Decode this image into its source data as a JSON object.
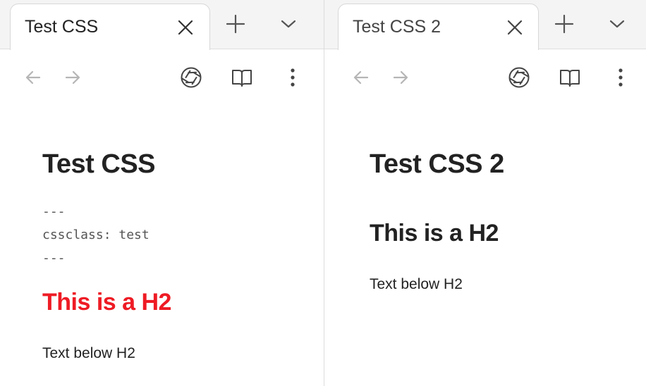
{
  "colors": {
    "h2_highlight": "#ee1b24",
    "text": "#222222",
    "icon_active": "#444444",
    "icon_disabled": "#b5b5b5",
    "tabbar_bg": "#f4f4f4"
  },
  "left_pane": {
    "tab": {
      "title": "Test CSS",
      "close_icon": "close-icon",
      "new_tab_icon": "plus-icon",
      "tab_list_icon": "chevron-down-icon"
    },
    "toolbar": {
      "back_icon": "arrow-left-icon",
      "forward_icon": "arrow-right-icon",
      "graph_icon": "aperture-icon",
      "reading_view_icon": "book-open-icon",
      "more_icon": "more-vertical-icon"
    },
    "note": {
      "title": "Test CSS",
      "frontmatter": [
        "---",
        "cssclass: test",
        "---"
      ],
      "h2": "This is a H2",
      "paragraph": "Text below H2"
    }
  },
  "right_pane": {
    "tab": {
      "title": "Test CSS 2",
      "close_icon": "close-icon",
      "new_tab_icon": "plus-icon",
      "tab_list_icon": "chevron-down-icon"
    },
    "toolbar": {
      "back_icon": "arrow-left-icon",
      "forward_icon": "arrow-right-icon",
      "graph_icon": "aperture-icon",
      "reading_view_icon": "book-open-icon",
      "more_icon": "more-vertical-icon"
    },
    "note": {
      "title": "Test CSS 2",
      "h2": "This is a H2",
      "paragraph": "Text below H2"
    }
  }
}
